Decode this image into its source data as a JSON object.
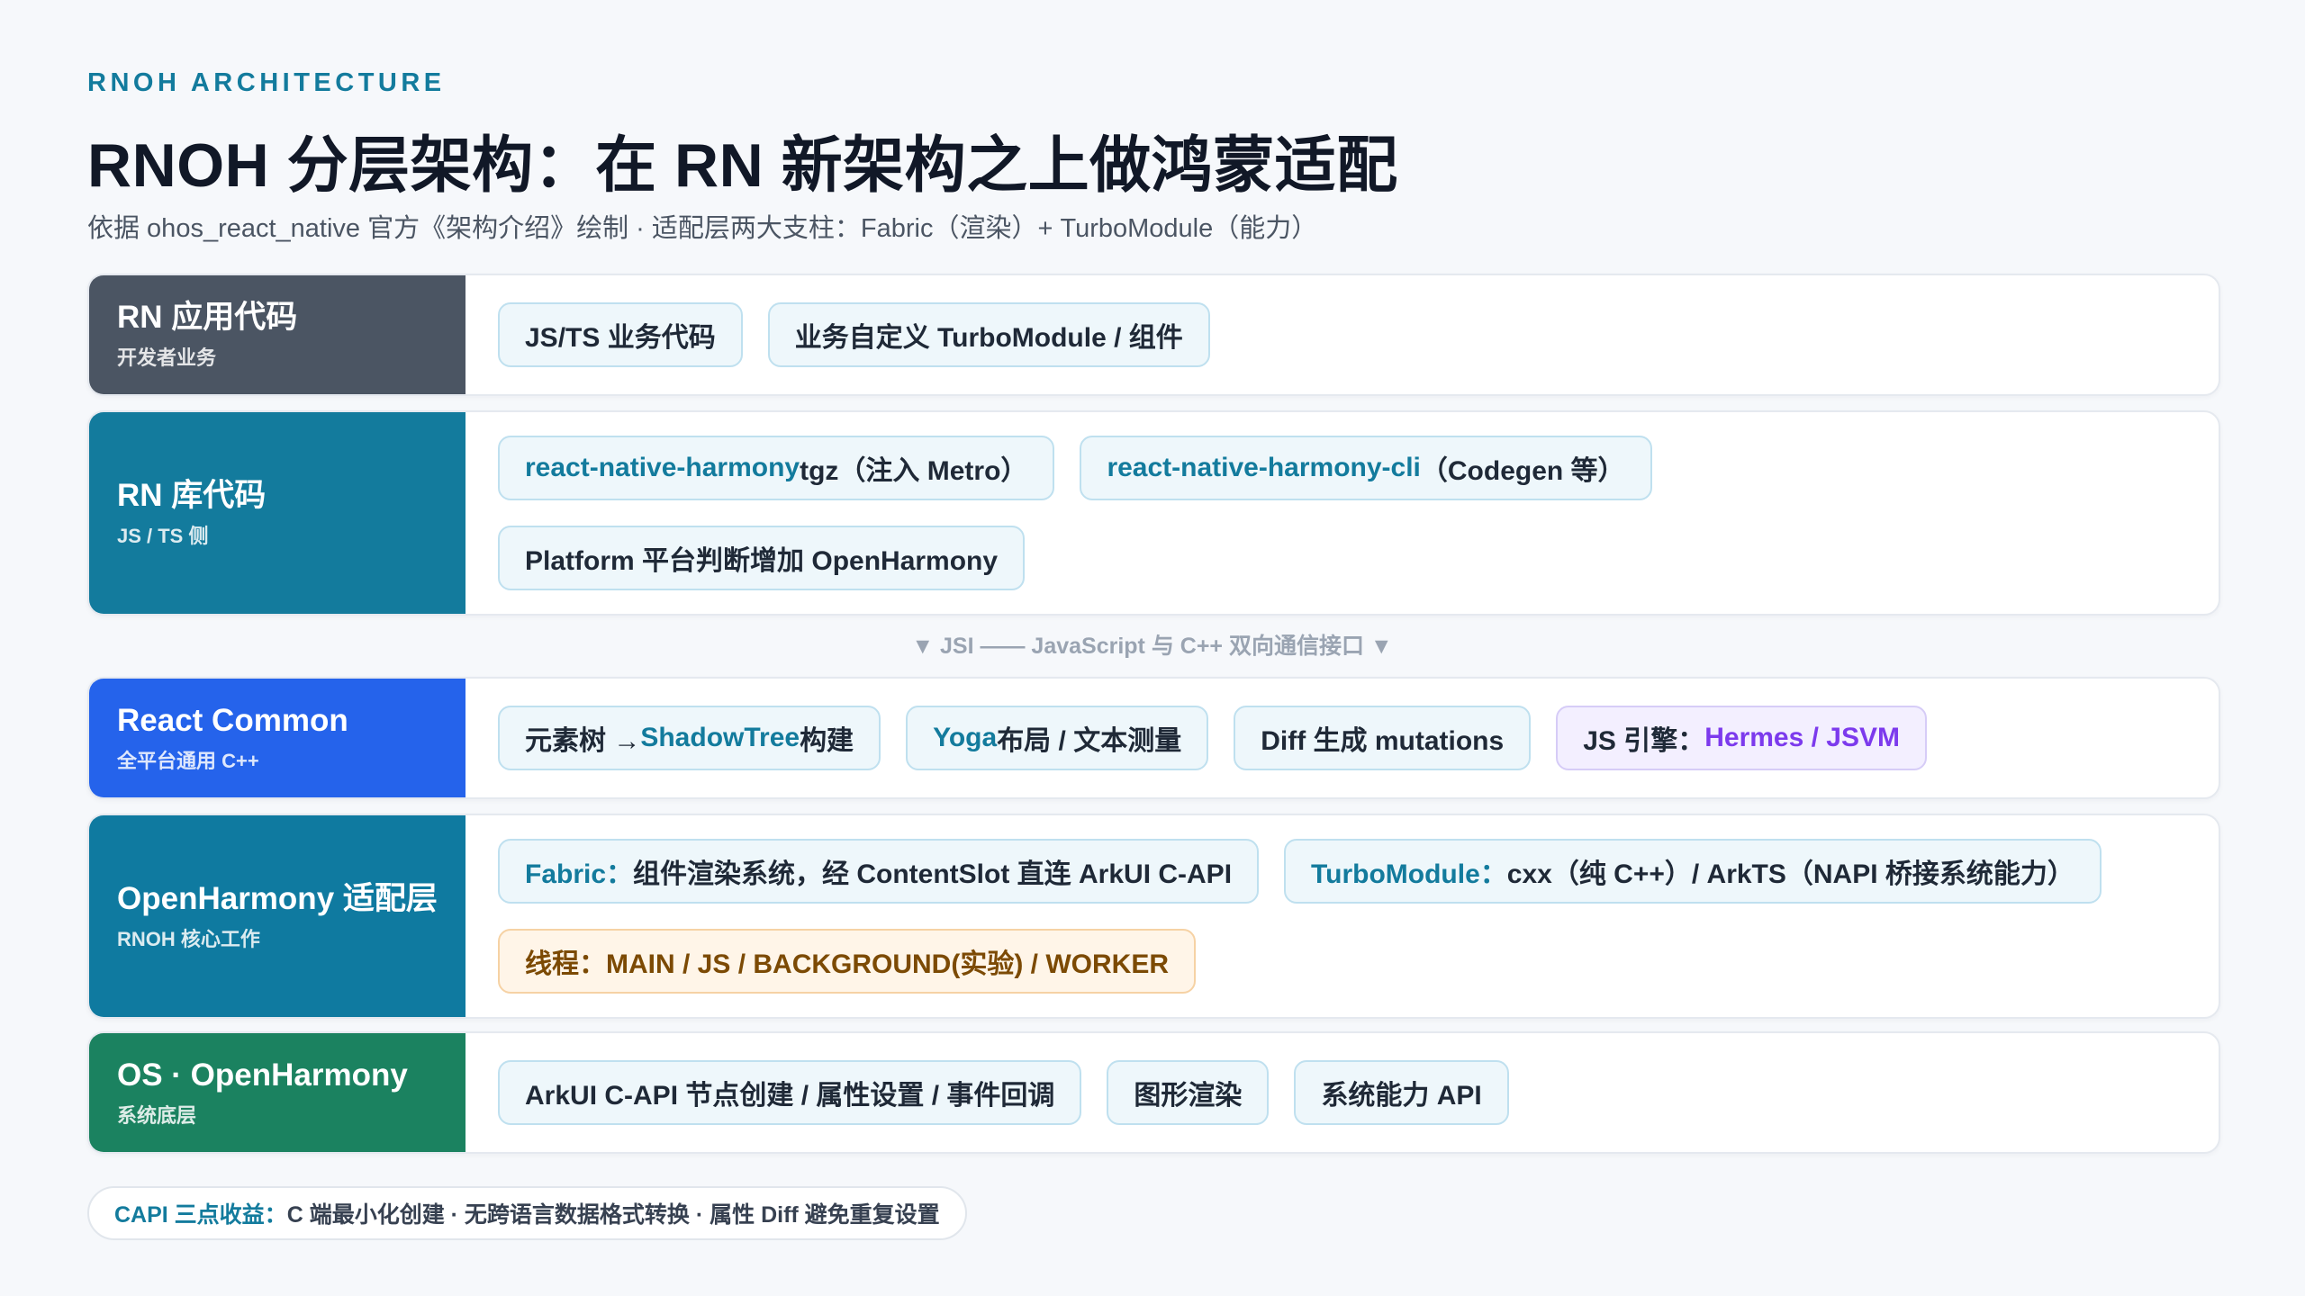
{
  "header": {
    "eyebrow": "RNOH ARCHITECTURE",
    "title": "RNOH 分层架构：在 RN 新架构之上做鸿蒙适配",
    "subtitle": "依据 ohos_react_native 官方《架构介绍》绘制 · 适配层两大支柱：Fabric（渲染）+ TurboModule（能力）"
  },
  "colors": {
    "app": "#4b5563",
    "lib": "#137b9d",
    "common": "#2563eb",
    "adapter": "#0f7aa0",
    "os": "#1b8260"
  },
  "layers": {
    "app": {
      "title": "RN 应用代码",
      "sub": "开发者业务",
      "chips": [
        "JS/TS 业务代码",
        "业务自定义 TurboModule / 组件"
      ]
    },
    "lib": {
      "title": "RN 库代码",
      "sub": "JS / TS 侧",
      "chip1_hl": "react-native-harmony",
      "chip1_rest": " tgz（注入 Metro）",
      "chip2_hl": "react-native-harmony-cli",
      "chip2_rest": "（Codegen 等）",
      "chip3": "Platform 平台判断增加 OpenHarmony"
    },
    "divider": "▼  JSI —— JavaScript 与 C++ 双向通信接口  ▼",
    "common": {
      "title": "React Common",
      "sub": "全平台通用 C++",
      "chip1_a": "元素树 → ",
      "chip1_hl": "ShadowTree",
      "chip1_b": " 构建",
      "chip2_hl": "Yoga",
      "chip2_rest": " 布局 / 文本测量",
      "chip3": "Diff 生成 mutations",
      "chip4_a": "JS 引擎：",
      "chip4_hl": "Hermes / JSVM"
    },
    "adapter": {
      "title": "OpenHarmony 适配层",
      "sub": "RNOH 核心工作",
      "chip1_hl": "Fabric：",
      "chip1_rest": "组件渲染系统，经 ContentSlot 直连 ArkUI C-API",
      "chip2_hl": "TurboModule：",
      "chip2_rest": "cxx（纯 C++）/ ArkTS（NAPI 桥接系统能力）",
      "chip3": "线程：MAIN / JS / BACKGROUND(实验) / WORKER"
    },
    "os": {
      "title": "OS · OpenHarmony",
      "sub": "系统底层",
      "chips": [
        "ArkUI C-API 节点创建 / 属性设置 / 事件回调",
        "图形渲染",
        "系统能力 API"
      ]
    }
  },
  "footer": {
    "label": "CAPI 三点收益：",
    "text": "C 端最小化创建 · 无跨语言数据格式转换 · 属性 Diff 避免重复设置"
  }
}
